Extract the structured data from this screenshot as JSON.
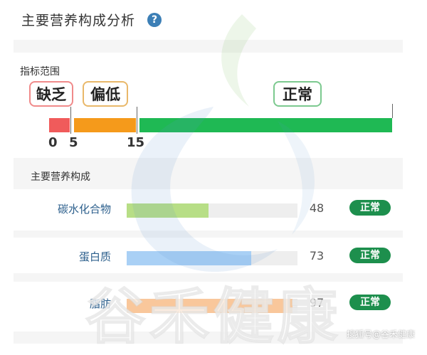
{
  "header": {
    "title": "主要营养构成分析",
    "help_icon": "?"
  },
  "range": {
    "section_label": "指标范围",
    "levels": [
      {
        "label": "缺乏",
        "color": "#f05b5b",
        "border": "#f08a8a"
      },
      {
        "label": "偏低",
        "color": "#f59a1b",
        "border": "#e9b86a"
      },
      {
        "label": "正常",
        "color": "#1fb954",
        "border": "#7cc98f"
      }
    ],
    "thresholds": [
      "0",
      "5",
      "15"
    ]
  },
  "composition": {
    "section_label": "主要营养构成",
    "items": [
      {
        "name": "碳水化合物",
        "value": "48",
        "percent": 48,
        "status": "正常",
        "color": "#b7de86"
      },
      {
        "name": "蛋白质",
        "value": "73",
        "percent": 73,
        "status": "正常",
        "color": "#a9d0f5"
      },
      {
        "name": "脂肪",
        "value": "97",
        "percent": 97,
        "status": "正常",
        "color": "#f9c79b"
      }
    ]
  },
  "watermark": {
    "text": "谷禾健康",
    "source": "搜狐号@谷禾健康"
  }
}
